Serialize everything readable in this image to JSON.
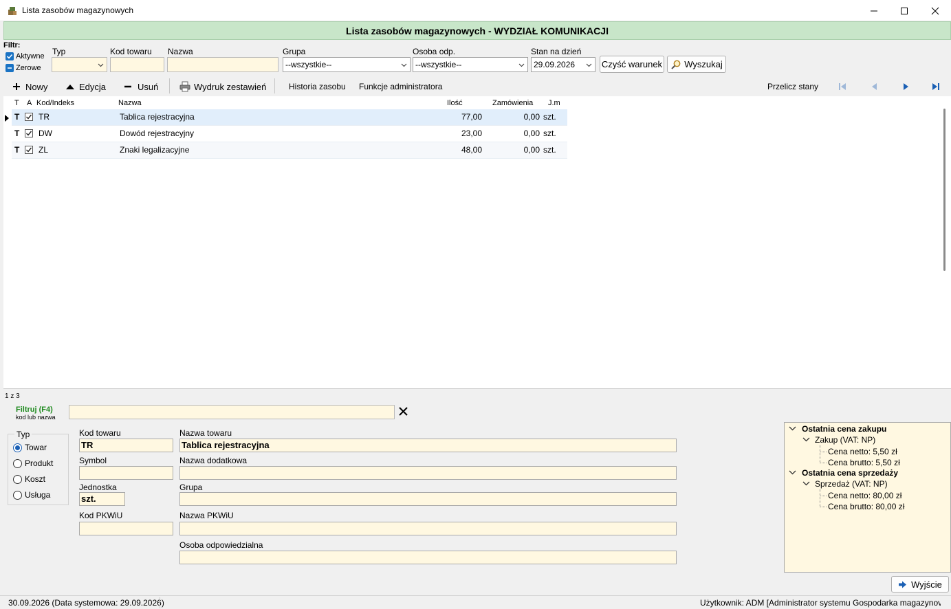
{
  "window": {
    "title": "Lista zasobów magazynowych"
  },
  "header": {
    "title": "Lista zasobów magazynowych - WYDZIAŁ KOMUNIKACJI"
  },
  "filter": {
    "label": "Filtr:",
    "active_label": "Aktywne",
    "zero_label": "Zerowe",
    "type_label": "Typ",
    "type_value": "",
    "code_label": "Kod towaru",
    "code_value": "",
    "name_label": "Nazwa",
    "name_value": "",
    "group_label": "Grupa",
    "group_value": "--wszystkie--",
    "person_label": "Osoba odp.",
    "person_value": "--wszystkie--",
    "date_label": "Stan na dzień",
    "date_value": "29.09.2026",
    "clear_button": "Czyść warunek",
    "search_button": "Wyszukaj"
  },
  "toolbar": {
    "new": "Nowy",
    "edit": "Edycja",
    "delete": "Usuń",
    "print": "Wydruk zestawień",
    "history": "Historia zasobu",
    "admin": "Funkcje administratora",
    "recalc": "Przelicz stany"
  },
  "grid": {
    "columns": [
      "T",
      "A",
      "Kod/Indeks",
      "Nazwa",
      "Ilość",
      "Zamówienia",
      "J.m"
    ],
    "rows": [
      {
        "t": "T",
        "code": "TR",
        "name": "Tablica rejestracyjna",
        "qty": "77,00",
        "orders": "0,00",
        "unit": "szt."
      },
      {
        "t": "T",
        "code": "DW",
        "name": "Dowód rejestracyjny",
        "qty": "23,00",
        "orders": "0,00",
        "unit": "szt."
      },
      {
        "t": "T",
        "code": "ZL",
        "name": "Znaki legalizacyjne",
        "qty": "48,00",
        "orders": "0,00",
        "unit": "szt."
      }
    ],
    "record_count": "1 z 3"
  },
  "quickfilter": {
    "label": "Filtruj (F4)",
    "hint": "kod lub nazwa",
    "value": ""
  },
  "detail": {
    "type_group_label": "Typ",
    "types": [
      "Towar",
      "Produkt",
      "Koszt",
      "Usługa"
    ],
    "selected_type": "Towar",
    "code_label": "Kod towaru",
    "code_value": "TR",
    "name_label": "Nazwa towaru",
    "name_value": "Tablica rejestracyjna",
    "symbol_label": "Symbol",
    "symbol_value": "",
    "extra_name_label": "Nazwa dodatkowa",
    "extra_name_value": "",
    "unit_label": "Jednostka",
    "unit_value": "szt.",
    "group_label": "Grupa",
    "group_value": "",
    "pkwiu_label": "Kod PKWiU",
    "pkwiu_value": "",
    "pkwiu_name_label": "Nazwa PKWiU",
    "pkwiu_name_value": "",
    "person_label": "Osoba odpowiedzialna",
    "person_value": ""
  },
  "prices": {
    "purchase_title": "Ostatnia cena zakupu",
    "purchase_node": "Zakup (VAT: NP)",
    "purchase_net": "Cena netto: 5,50 zł",
    "purchase_gross": "Cena brutto: 5,50 zł",
    "sale_title": "Ostatnia cena sprzedaży",
    "sale_node": "Sprzedaż (VAT: NP)",
    "sale_net": "Cena netto: 80,00 zł",
    "sale_gross": "Cena brutto: 80,00 zł"
  },
  "exit_button": "Wyjście",
  "status": {
    "date": "30.09.2026 (Data systemowa: 29.09.2026)",
    "user": "Użytkownik: ADM [Administrator systemu Gospodarka magazynov"
  },
  "colors": {
    "header_band": "#c8e6c9",
    "field_bg": "#fff8e1",
    "accent": "#1a73c4",
    "quickfilter_label": "#1e8a1e"
  },
  "icons": [
    "app-icon",
    "minimize-icon",
    "maximize-icon",
    "close-icon",
    "search-icon",
    "plus-icon",
    "triangle-up-icon",
    "minus-icon",
    "printer-icon",
    "first-icon",
    "prev-icon",
    "next-icon",
    "last-icon",
    "exit-arrow-icon"
  ]
}
